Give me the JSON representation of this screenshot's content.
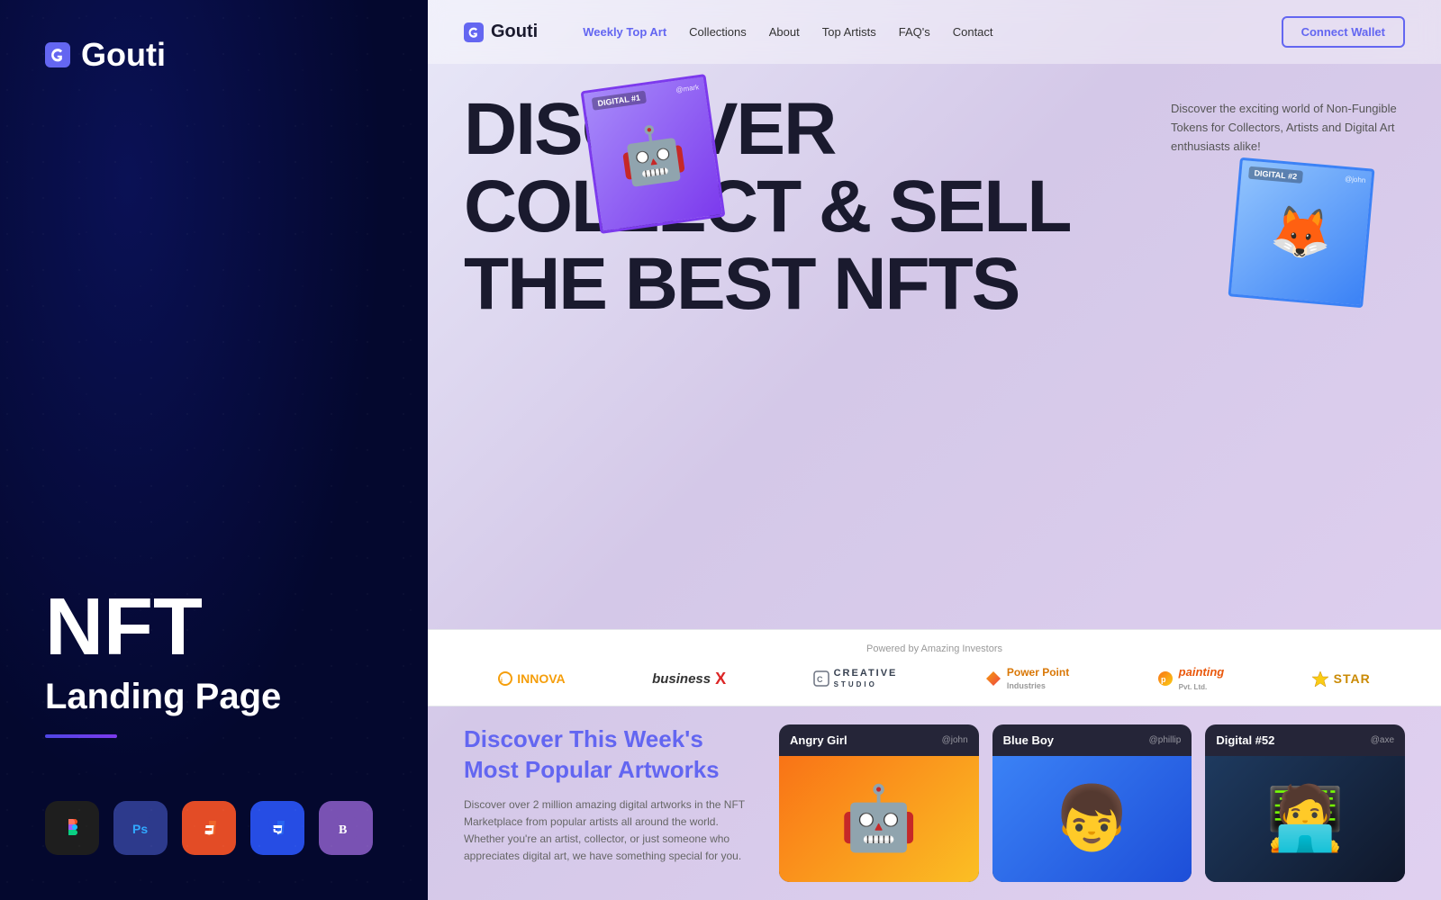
{
  "left": {
    "logo": "Gouti",
    "nft_title": "NFT",
    "landing_subtitle": "Landing Page",
    "tools": [
      {
        "name": "Figma",
        "icon": "🎨",
        "bg": "tool-figma"
      },
      {
        "name": "Photoshop",
        "icon": "🖼",
        "bg": "tool-ps"
      },
      {
        "name": "HTML5",
        "icon": "5",
        "bg": "tool-html"
      },
      {
        "name": "CSS3",
        "icon": "3",
        "bg": "tool-css"
      },
      {
        "name": "Bootstrap",
        "icon": "B",
        "bg": "tool-bootstrap"
      }
    ]
  },
  "nav": {
    "logo": "Gouti",
    "links": [
      {
        "label": "Weekly Top Art",
        "active": true
      },
      {
        "label": "Collections",
        "active": false
      },
      {
        "label": "About",
        "active": false
      },
      {
        "label": "Top Artists",
        "active": false
      },
      {
        "label": "FAQ's",
        "active": false
      },
      {
        "label": "Contact",
        "active": false
      }
    ],
    "cta": "Connect Wallet"
  },
  "hero": {
    "line1": "DISCOVER",
    "line2": "COLLECT & SELL",
    "line3": "THE BEST NFTs",
    "description": "Discover the exciting world of Non-Fungible Tokens for Collectors, Artists and Digital Art enthusiasts alike!",
    "card1": {
      "label": "DIGITAL #1",
      "author": "@mark"
    },
    "card2": {
      "label": "DIGITAL #2",
      "author": "@john"
    }
  },
  "investors": {
    "label": "Powered by Amazing Investors",
    "logos": [
      {
        "name": "INNOVA",
        "class": "logo-innova"
      },
      {
        "name": "businessX",
        "class": "logo-business"
      },
      {
        "name": "CREATIVE STUDIO",
        "class": "logo-creative"
      },
      {
        "name": "Power Point Industries",
        "class": "logo-powerpoint"
      },
      {
        "name": "painting Pvt. Ltd.",
        "class": "logo-painting"
      },
      {
        "name": "STAR",
        "class": "logo-star"
      }
    ]
  },
  "artworks": {
    "title": "Discover This Week's Most Popular",
    "title_highlight": "Artworks",
    "description": "Discover over 2 million amazing digital artworks in the NFT Marketplace from popular artists all around the world. Whether you're an artist, collector, or just someone who appreciates digital art, we have something special for you.",
    "cards": [
      {
        "name": "Angry Girl",
        "author": "@john",
        "emoji": "🤖",
        "class": "artwork-card-1"
      },
      {
        "name": "Blue Boy",
        "author": "@phillip",
        "emoji": "👦",
        "class": "artwork-card-2"
      },
      {
        "name": "Digital #52",
        "author": "@axe",
        "emoji": "🧑‍💻",
        "class": "artwork-card-3"
      }
    ]
  }
}
